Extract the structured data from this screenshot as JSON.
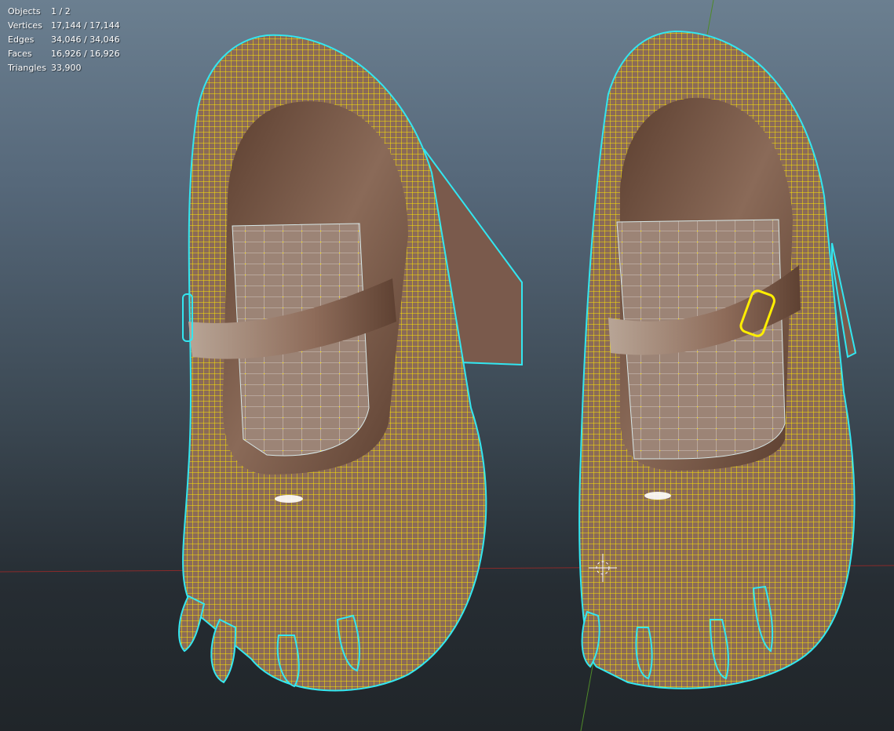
{
  "stats": [
    {
      "label": "Objects",
      "value": "1 / 2"
    },
    {
      "label": "Vertices",
      "value": "17,144 / 17,144"
    },
    {
      "label": "Edges",
      "value": "34,046 / 34,046"
    },
    {
      "label": "Faces",
      "value": "16,926 / 16,926"
    },
    {
      "label": "Triangles",
      "value": "33,900"
    }
  ],
  "colors": {
    "wire": "#ffee00",
    "outline": "#33e6f0",
    "leather": "#7a5646",
    "strap": "#9c8476",
    "x_axis": "#8a2a2a",
    "y_axis": "#4f8a2a"
  }
}
